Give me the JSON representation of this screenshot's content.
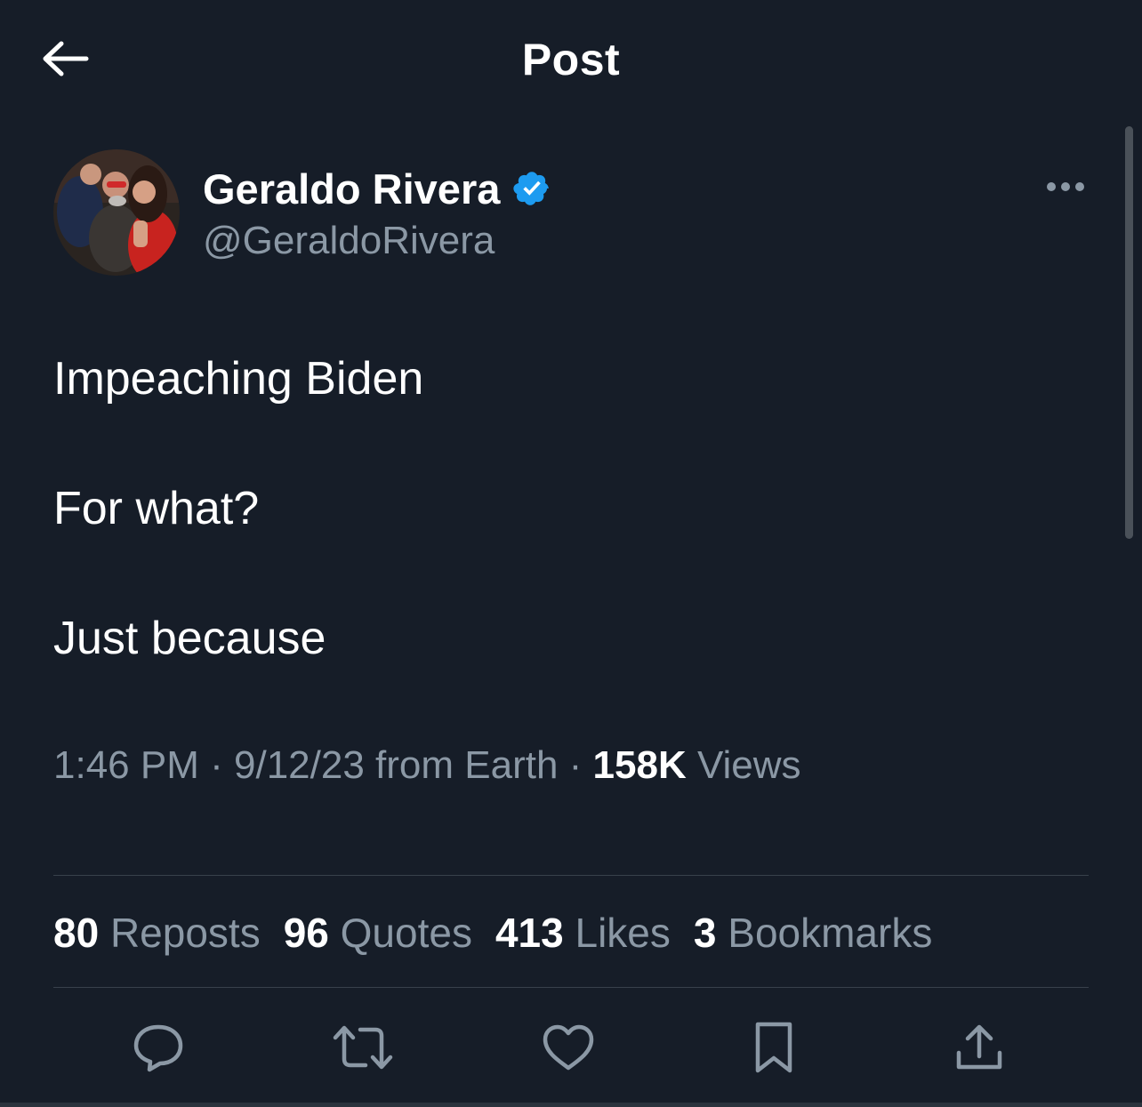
{
  "header": {
    "title": "Post",
    "back_icon": "arrow-left-icon"
  },
  "author": {
    "display_name": "Geraldo Rivera",
    "handle": "@GeraldoRivera",
    "verified": true,
    "verified_color": "#1d9bf0"
  },
  "post": {
    "lines": [
      "Impeaching Biden",
      "For what?",
      "Just because"
    ]
  },
  "meta": {
    "time": "1:46 PM",
    "separator": "·",
    "date_source": "9/12/23 from Earth",
    "views_count": "158K",
    "views_label": "Views"
  },
  "stats": [
    {
      "count": "80",
      "label": "Reposts"
    },
    {
      "count": "96",
      "label": "Quotes"
    },
    {
      "count": "413",
      "label": "Likes"
    },
    {
      "count": "3",
      "label": "Bookmarks"
    }
  ],
  "actions": [
    "reply-icon",
    "repost-icon",
    "like-icon",
    "bookmark-icon",
    "share-icon"
  ],
  "colors": {
    "background": "#161d28",
    "text_primary": "#ffffff",
    "text_secondary": "#8b98a5",
    "divider": "#38414b"
  }
}
